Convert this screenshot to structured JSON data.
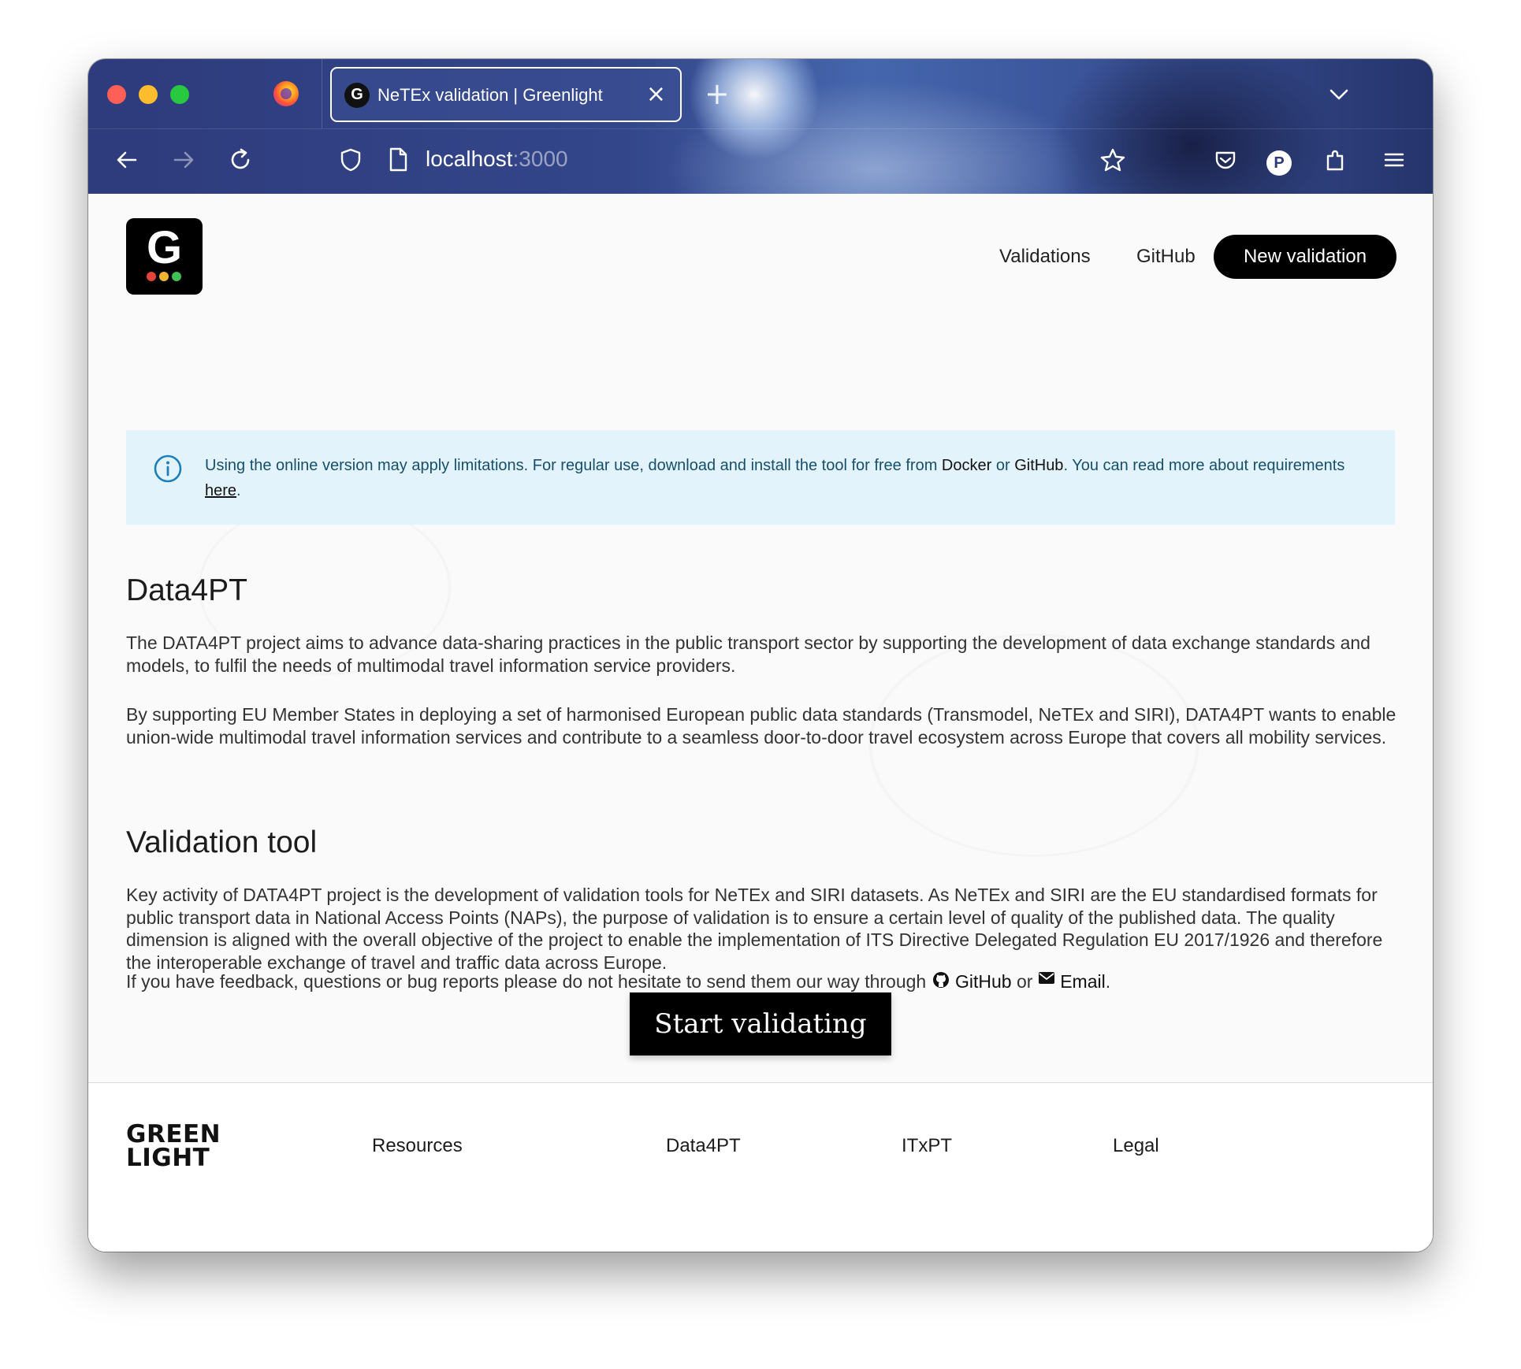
{
  "browser": {
    "tab_title": "NeTEx validation | Greenlight",
    "tab_favicon": "G",
    "url_host": "localhost",
    "url_port": ":3000",
    "profile_initial": "P"
  },
  "header": {
    "logo_letter": "G",
    "nav": {
      "validations": "Validations",
      "github": "GitHub"
    },
    "new_validation": "New validation"
  },
  "notice": {
    "text_1": "Using the online version may apply limitations. For regular use, download and install the tool for free from ",
    "docker": "Docker",
    "or": " or ",
    "github": "GitHub",
    "text_2": ". You can read more about requirements ",
    "here": "here",
    "end": "."
  },
  "data4pt": {
    "heading": "Data4PT",
    "p1": "The DATA4PT project aims to advance data-sharing practices in the public transport sector by supporting the development of data exchange standards and models, to fulfil the needs of multimodal travel information service providers.",
    "p2": "By supporting EU Member States in deploying a set of harmonised European public data standards (Transmodel, NeTEx and SIRI), DATA4PT wants to enable union-wide multimodal travel information services and contribute to a seamless door-to-door travel ecosystem across Europe that covers all mobility services."
  },
  "validation_tool": {
    "heading": "Validation tool",
    "p1": "Key activity of DATA4PT project is the development of validation tools for NeTEx and SIRI datasets. As NeTEx and SIRI are the EU standardised formats for public transport data in National Access Points (NAPs), the purpose of validation is to ensure a certain level of quality of the published data. The quality dimension is aligned with the overall objective of the project to enable the implementation of ITS Directive Delegated Regulation EU 2017/1926 and therefore the interoperable exchange of travel and traffic data across Europe.",
    "feedback_text": "If you have feedback, questions or bug reports please do not hesitate to send them our way through ",
    "feedback_github": "GitHub",
    "feedback_or": " or ",
    "feedback_email": "Email",
    "feedback_end": ".",
    "start_button": "Start validating"
  },
  "footer": {
    "logo_line1": "GREEN",
    "logo_line2": "LIGHT",
    "links": [
      "Resources",
      "Data4PT",
      "ITxPT",
      "Legal"
    ]
  },
  "colors": {
    "traffic_red": "#fe5f57",
    "traffic_yellow": "#febc2e",
    "traffic_green": "#28c840",
    "logo_dot_red": "#e5443b",
    "logo_dot_yellow": "#f2b531",
    "logo_dot_green": "#3fbf55",
    "notice_bg": "#e3f3fb",
    "notice_text": "#164f6a"
  }
}
